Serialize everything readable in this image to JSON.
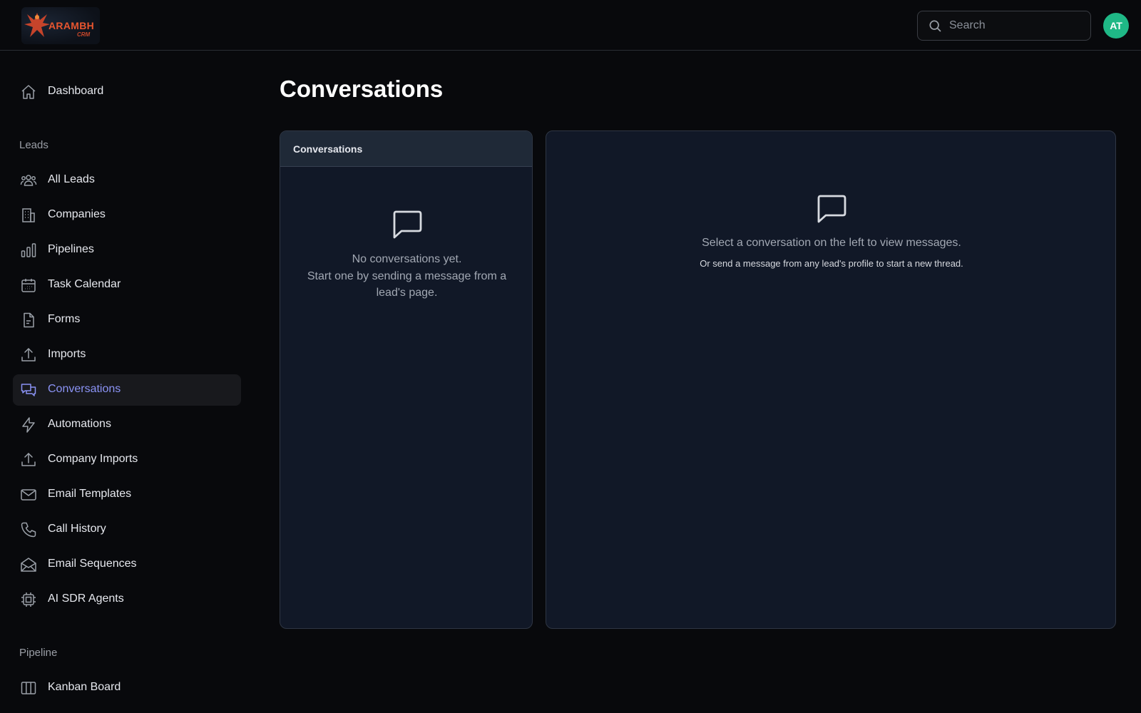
{
  "header": {
    "logo_text": "ARAMBH",
    "logo_sub": "CRM",
    "search_placeholder": "Search",
    "avatar_initials": "AT"
  },
  "sidebar": {
    "top_item": {
      "label": "Dashboard",
      "icon": "home-icon"
    },
    "leads_section_label": "Leads",
    "leads_items": [
      {
        "label": "All Leads",
        "icon": "users-icon"
      },
      {
        "label": "Companies",
        "icon": "building-icon"
      },
      {
        "label": "Pipelines",
        "icon": "bar-chart-icon"
      },
      {
        "label": "Task Calendar",
        "icon": "calendar-icon"
      },
      {
        "label": "Forms",
        "icon": "file-icon"
      },
      {
        "label": "Imports",
        "icon": "upload-icon"
      },
      {
        "label": "Conversations",
        "icon": "chat-icon",
        "active": true
      },
      {
        "label": "Automations",
        "icon": "bolt-icon"
      },
      {
        "label": "Company Imports",
        "icon": "upload-icon"
      },
      {
        "label": "Email Templates",
        "icon": "mail-icon"
      },
      {
        "label": "Call History",
        "icon": "phone-icon"
      },
      {
        "label": "Email Sequences",
        "icon": "mail-open-icon"
      },
      {
        "label": "AI SDR Agents",
        "icon": "chip-icon"
      }
    ],
    "pipeline_section_label": "Pipeline",
    "pipeline_items": [
      {
        "label": "Kanban Board",
        "icon": "kanban-icon"
      }
    ]
  },
  "main": {
    "page_title": "Conversations",
    "list_panel": {
      "header": "Conversations",
      "empty_line1": "No conversations yet.",
      "empty_line2": "Start one by sending a message from a lead's page."
    },
    "detail_panel": {
      "message1": "Select a conversation on the left to view messages.",
      "message2": "Or send a message from any lead's profile to start a new thread."
    }
  },
  "colors": {
    "background": "#08090c",
    "panel": "#111827",
    "panel_header": "#1f2937",
    "accent_active": "#8b93f5",
    "avatar": "#1fb886",
    "logo": "#e8552f"
  }
}
